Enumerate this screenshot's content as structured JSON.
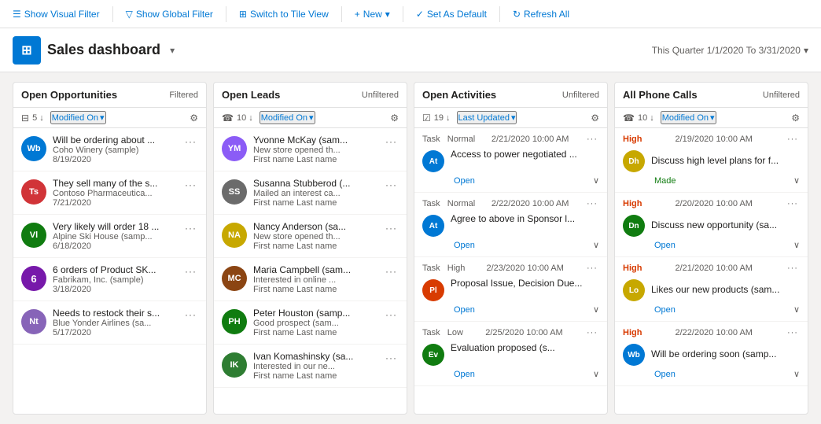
{
  "toolbar": {
    "visual_filter": "Show Visual Filter",
    "global_filter": "Show Global Filter",
    "tile_view": "Switch to Tile View",
    "new": "New",
    "set_default": "Set As Default",
    "refresh": "Refresh All"
  },
  "header": {
    "title": "Sales dashboard",
    "date_range": "This Quarter 1/1/2020 To 3/31/2020",
    "logo_initials": "⊞"
  },
  "columns": [
    {
      "id": "open-opportunities",
      "title": "Open Opportunities",
      "status": "Filtered",
      "count": 5,
      "sort_label": "Modified On",
      "cards": [
        {
          "avatar_text": "Wb",
          "avatar_color": "#0078d4",
          "title": "Will be ordering about ...",
          "sub": "Coho Winery (sample)",
          "date": "8/19/2020",
          "type": "text"
        },
        {
          "avatar_text": "Ts",
          "avatar_color": "#d13438",
          "title": "They sell many of the s...",
          "sub": "Contoso Pharmaceutica...",
          "date": "7/21/2020",
          "type": "text"
        },
        {
          "avatar_text": "Vl",
          "avatar_color": "#107c10",
          "title": "Very likely will order 18 ...",
          "sub": "Alpine Ski House (samp...",
          "date": "6/18/2020",
          "type": "text"
        },
        {
          "avatar_text": "6",
          "avatar_color": "#7719aa",
          "title": "6 orders of Product SK...",
          "sub": "Fabrikam, Inc. (sample)",
          "date": "3/18/2020",
          "type": "number"
        },
        {
          "avatar_text": "Nt",
          "avatar_color": "#8764b8",
          "title": "Needs to restock their s...",
          "sub": "Blue Yonder Airlines (sa...",
          "date": "5/17/2020",
          "type": "text"
        }
      ]
    },
    {
      "id": "open-leads",
      "title": "Open Leads",
      "status": "Unfiltered",
      "count": 10,
      "sort_label": "Modified On",
      "cards": [
        {
          "avatar_text": "YM",
          "avatar_color": "#8b5cf6",
          "title": "Yvonne McKay (sam...",
          "sub": "New store opened th...",
          "meta": "First name Last name",
          "type": "text"
        },
        {
          "avatar_text": "SS",
          "avatar_color": "#6b6b6b",
          "title": "Susanna Stubberod (...",
          "sub": "Mailed an interest ca...",
          "meta": "First name Last name",
          "type": "text"
        },
        {
          "avatar_text": "NA",
          "avatar_color": "#c7a800",
          "title": "Nancy Anderson (sa...",
          "sub": "New store opened th...",
          "meta": "First name Last name",
          "type": "text"
        },
        {
          "avatar_text": "MC",
          "avatar_color": "#8b4513",
          "title": "Maria Campbell (sam...",
          "sub": "Interested in online ...",
          "meta": "First name Last name",
          "type": "text"
        },
        {
          "avatar_text": "PH",
          "avatar_color": "#107c10",
          "title": "Peter Houston (samp...",
          "sub": "Good prospect (sam...",
          "meta": "First name Last name",
          "type": "text"
        },
        {
          "avatar_text": "IK",
          "avatar_color": "#2e7d32",
          "title": "Ivan Komashinsky (sa...",
          "sub": "Interested in our ne...",
          "meta": "First name Last name",
          "type": "text"
        }
      ]
    },
    {
      "id": "open-activities",
      "title": "Open Activities",
      "status": "Unfiltered",
      "count": 19,
      "sort_label": "Last Updated",
      "activities": [
        {
          "type_label": "Task",
          "priority": "Normal",
          "datetime": "2/21/2020 10:00 AM",
          "avatar_text": "At",
          "avatar_color": "#0078d4",
          "title": "Access to power negotiated ...",
          "status": "Open"
        },
        {
          "type_label": "Task",
          "priority": "Normal",
          "datetime": "2/22/2020 10:00 AM",
          "avatar_text": "At",
          "avatar_color": "#0078d4",
          "title": "Agree to above in Sponsor l...",
          "status": "Open"
        },
        {
          "type_label": "Task",
          "priority": "High",
          "datetime": "2/23/2020 10:00 AM",
          "avatar_text": "Pl",
          "avatar_color": "#d83b01",
          "title": "Proposal Issue, Decision Due...",
          "status": "Open"
        },
        {
          "type_label": "Task",
          "priority": "Low",
          "datetime": "2/25/2020 10:00 AM",
          "avatar_text": "Ev",
          "avatar_color": "#107c10",
          "title": "Evaluation proposed (s...",
          "status": "Open"
        }
      ]
    },
    {
      "id": "all-phone-calls",
      "title": "All Phone Calls",
      "status": "Unfiltered",
      "count": 10,
      "sort_label": "Modified On",
      "calls": [
        {
          "priority": "High",
          "datetime": "2/19/2020 10:00 AM",
          "avatar_text": "Dh",
          "avatar_color": "#c7a800",
          "title": "Discuss high level plans for f...",
          "status": "Made"
        },
        {
          "priority": "High",
          "datetime": "2/20/2020 10:00 AM",
          "avatar_text": "Dn",
          "avatar_color": "#107c10",
          "title": "Discuss new opportunity (sa...",
          "status": "Open"
        },
        {
          "priority": "High",
          "datetime": "2/21/2020 10:00 AM",
          "avatar_text": "Lo",
          "avatar_color": "#c7a800",
          "title": "Likes our new products (sam...",
          "status": "Open"
        },
        {
          "priority": "High",
          "datetime": "2/22/2020 10:00 AM",
          "avatar_text": "Wb",
          "avatar_color": "#0078d4",
          "title": "Will be ordering soon (samp...",
          "status": "Open"
        }
      ]
    }
  ]
}
